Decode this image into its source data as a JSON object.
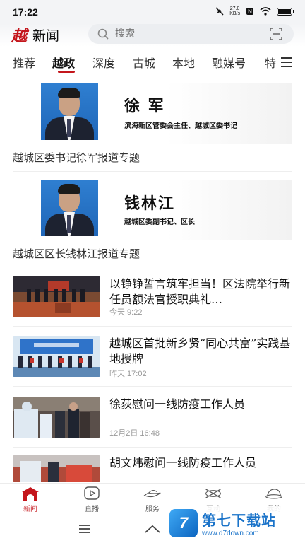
{
  "status_bar": {
    "time": "17:22",
    "net_speed_top": "27.0",
    "net_speed_bottom": "KB/s",
    "icons": [
      "mute-icon",
      "network-speed",
      "nfc-icon",
      "wifi-icon",
      "battery-icon"
    ]
  },
  "header": {
    "logo_mark": "越",
    "logo_text": "新闻",
    "search_placeholder": "搜索"
  },
  "tabs": [
    {
      "label": "推荐",
      "active": false
    },
    {
      "label": "越政",
      "active": true
    },
    {
      "label": "深度",
      "active": false
    },
    {
      "label": "古城",
      "active": false
    },
    {
      "label": "本地",
      "active": false
    },
    {
      "label": "融媒号",
      "active": false
    },
    {
      "label": "特",
      "active": false
    }
  ],
  "features": [
    {
      "name": "徐    军",
      "role": "滨海新区管委会主任、越城区委书记",
      "title": "越城区委书记徐军报道专题"
    },
    {
      "name": "钱林江",
      "role": "越城区委副书记、区长",
      "title": "越城区区长钱林江报道专题"
    }
  ],
  "news": [
    {
      "title": "以铮铮誓言筑牢担当！区法院举行新任员额法官授职典礼…",
      "time": "今天  9:22"
    },
    {
      "title": "越城区首批新乡贤“同心共富”实践基地授牌",
      "time": "昨天  17:02"
    },
    {
      "title": "徐荻慰问一线防疫工作人员",
      "time": "12月2日  16:48"
    },
    {
      "title": "胡文炜慰问一线防疫工作人员",
      "time": ""
    }
  ],
  "bottom_nav": [
    {
      "label": "新闻",
      "icon": "gate-icon",
      "active": true
    },
    {
      "label": "直播",
      "icon": "live-icon",
      "active": false
    },
    {
      "label": "服务",
      "icon": "boat-icon",
      "active": false
    },
    {
      "label": "互动",
      "icon": "oars-icon",
      "active": false
    },
    {
      "label": "我的",
      "icon": "hat-icon",
      "active": false
    }
  ],
  "watermark": {
    "logo_letter": "7",
    "name": "第七下载站",
    "url": "www.d7down.com"
  },
  "colors": {
    "accent": "#c4161c",
    "portrait_bg": "#2f7fd1",
    "watermark": "#1a73c9"
  }
}
